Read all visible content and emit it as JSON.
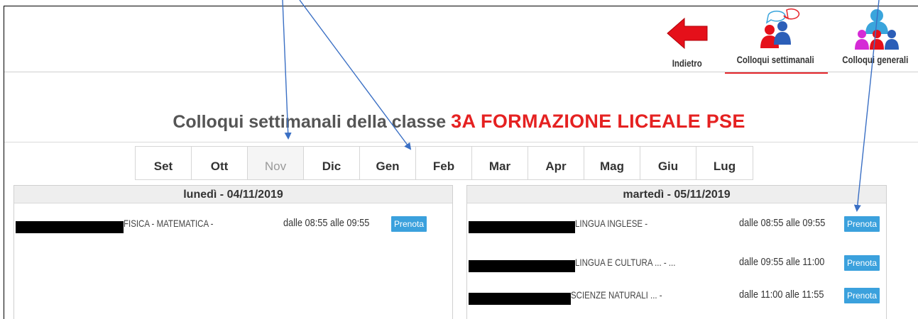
{
  "nav": {
    "back_label": "Indietro",
    "weekly_label": "Colloqui settimanali",
    "general_label": "Colloqui generali"
  },
  "title": {
    "main": "Colloqui settimanali della classe",
    "class_name": "3A FORMAZIONE LICEALE PSE"
  },
  "months": [
    "Set",
    "Ott",
    "Nov",
    "Dic",
    "Gen",
    "Feb",
    "Mar",
    "Apr",
    "Mag",
    "Giu",
    "Lug"
  ],
  "active_month": "Nov",
  "days": [
    {
      "header": "lunedì - 04/11/2019",
      "slots": [
        {
          "subject": "FISICA - MATEMATICA -",
          "time": "dalle 08:55 alle 09:55",
          "button": "Prenota"
        }
      ]
    },
    {
      "header": "martedì - 05/11/2019",
      "slots": [
        {
          "subject": "LINGUA INGLESE -",
          "time": "dalle 08:55 alle 09:55",
          "button": "Prenota"
        },
        {
          "subject": "LINGUA E CULTURA ... - ...",
          "time": "dalle 09:55 alle 11:00",
          "button": "Prenota"
        },
        {
          "subject": "SCIENZE NATURALI ... -",
          "time": "dalle 11:00 alle 11:55",
          "button": "Prenota"
        }
      ]
    }
  ],
  "colors": {
    "accent_red": "#e52121",
    "button_blue": "#3ba1dd",
    "arrow_blue": "#3a6fc4"
  },
  "icons": [
    "back-arrow-icon",
    "weekly-meetings-icon",
    "general-meetings-icon"
  ]
}
